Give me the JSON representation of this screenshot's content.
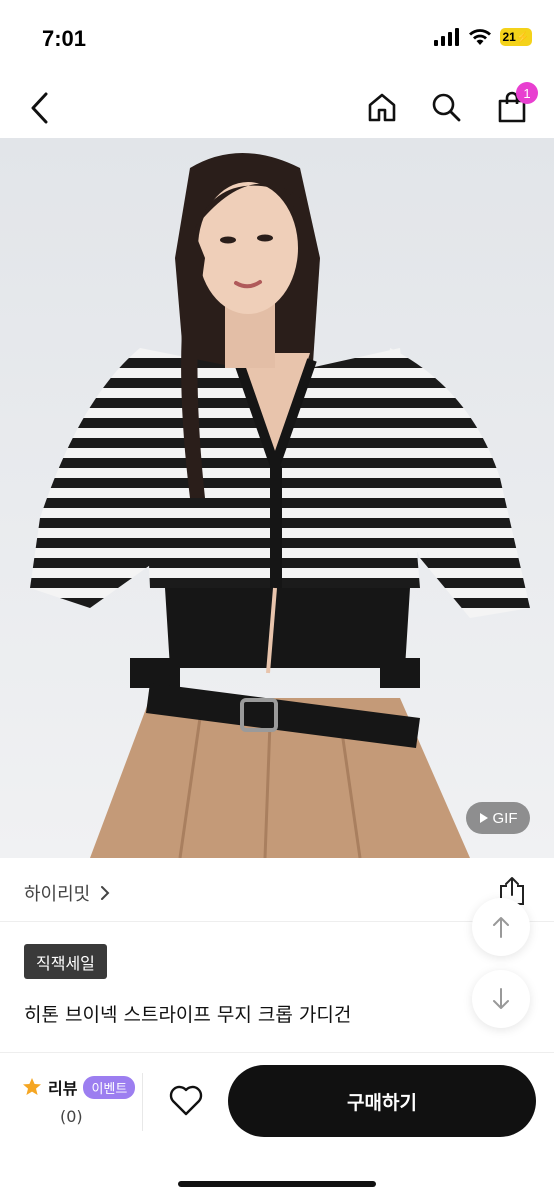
{
  "status_bar": {
    "time": "7:01",
    "battery": "21"
  },
  "nav": {
    "back_icon": "chevron-left-icon",
    "home_icon": "home-icon",
    "search_icon": "search-icon",
    "cart_icon": "shopping-bag-icon",
    "cart_count": "1"
  },
  "product": {
    "gif_label": "GIF",
    "seller": "하이리밋",
    "tag": "직잭세일",
    "title": "히톤 브이넥 스트라이프 무지 크롭 가디건"
  },
  "bottom": {
    "review_label": "리뷰",
    "event_label": "이벤트",
    "review_count": "(0)",
    "buy_label": "구매하기"
  },
  "colors": {
    "accent_badge": "#e83fd0",
    "event_pill": "#9c7ef0",
    "buy_button": "#111111",
    "star": "#f5a623"
  }
}
